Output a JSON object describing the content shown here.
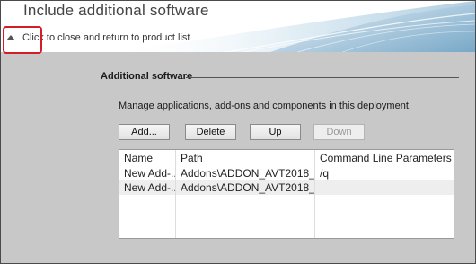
{
  "header": {
    "title": "Include additional software",
    "collapse_label": "Click to close and return to product list"
  },
  "section": {
    "heading": "Additional software",
    "description": "Manage applications, add-ons and components in this deployment."
  },
  "buttons": {
    "add": "Add...",
    "delete": "Delete",
    "up": "Up",
    "down": "Down"
  },
  "table": {
    "columns": [
      "Name",
      "Path",
      "Command Line Parameters"
    ],
    "rows": [
      {
        "name": "New Add-...",
        "path": "Addons\\ADDON_AVT2018_...",
        "params": "/q"
      },
      {
        "name": "New Add-...",
        "path": "Addons\\ADDON_AVT2018_...",
        "params": ""
      }
    ]
  },
  "colors": {
    "panel_bg": "#c8c8c8",
    "highlight_border": "#d41e25"
  }
}
